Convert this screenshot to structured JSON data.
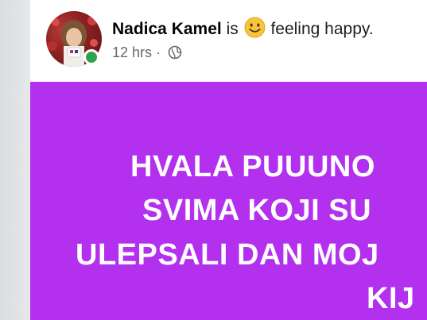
{
  "post": {
    "author": {
      "name": "Nadica Kamel",
      "online": true
    },
    "activity": {
      "verb": "is",
      "emoji_icon": "smiling-face-emoji",
      "text": "feeling happy."
    },
    "meta": {
      "time": "12 hrs",
      "separator": "·",
      "audience_icon": "globe-icon"
    },
    "body": {
      "background": "#b230ee",
      "text_color": "#ffffff",
      "lines": [
        "HVALA PUUUNO",
        "SVIMA KOJI SU",
        "ULEPSALI DAN MOJ",
        "KIJ"
      ]
    }
  }
}
